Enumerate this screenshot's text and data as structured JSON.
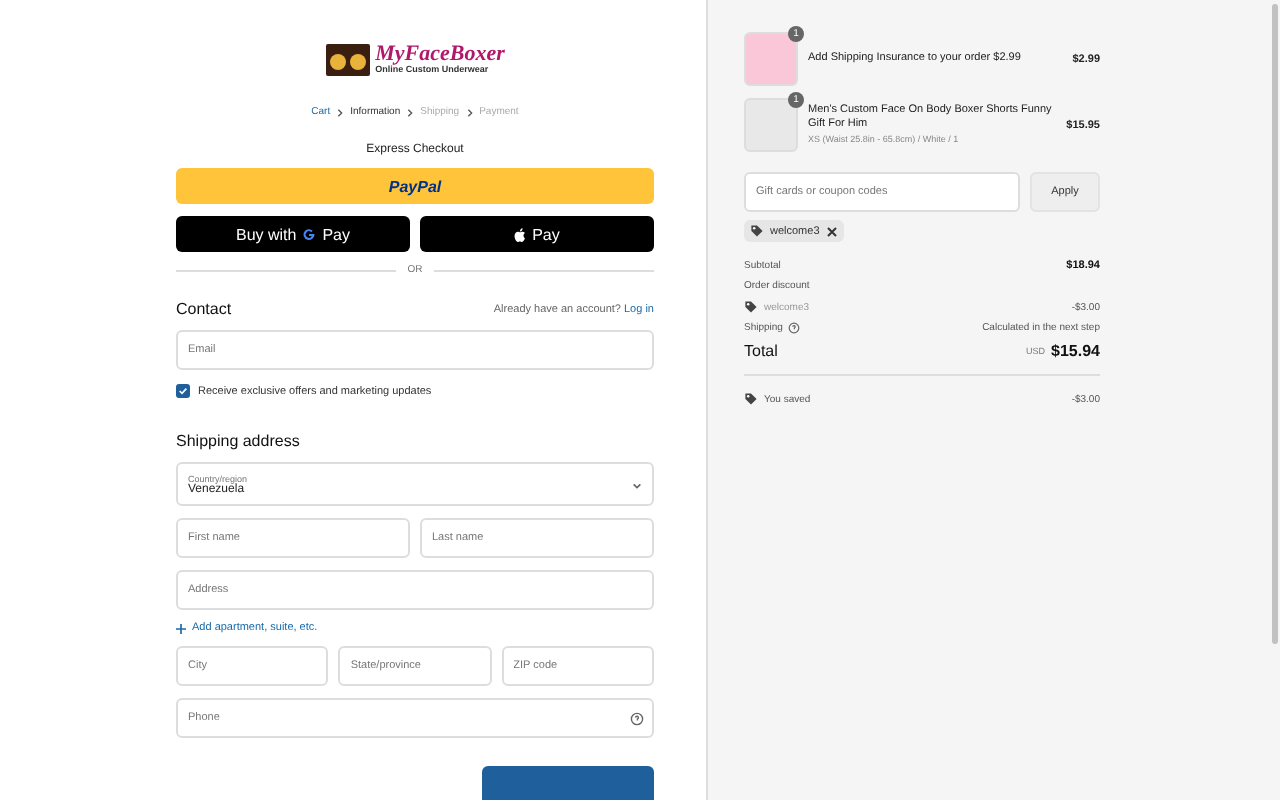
{
  "logo": {
    "name": "MyFaceBoxer",
    "tagline": "Online Custom Underwear"
  },
  "breadcrumbs": [
    {
      "label": "Cart",
      "kind": "link"
    },
    {
      "label": "Information",
      "kind": "current"
    },
    {
      "label": "Shipping",
      "kind": "pending"
    },
    {
      "label": "Payment",
      "kind": "pending"
    }
  ],
  "express": {
    "title": "Express Checkout",
    "paypal": "PayPal",
    "gpay_prefix": "Buy with",
    "gpay": "Pay",
    "applepay": "Pay",
    "divider": "OR"
  },
  "contact": {
    "title": "Contact",
    "account_prompt": "Already have an account?",
    "login": "Log in",
    "email": {
      "placeholder": "Email"
    },
    "marketing": {
      "label": "Receive exclusive offers and marketing updates",
      "checked": true
    }
  },
  "shipping": {
    "title": "Shipping address",
    "country": {
      "label": "Country/region",
      "value": "Venezuela"
    },
    "first_name": {
      "placeholder": "First name"
    },
    "last_name": {
      "placeholder": "Last name"
    },
    "address": {
      "placeholder": "Address"
    },
    "add_apartment": "Add apartment, suite, etc.",
    "city": {
      "placeholder": "City"
    },
    "state": {
      "placeholder": "State/province"
    },
    "zip": {
      "placeholder": "ZIP code"
    },
    "phone": {
      "placeholder": "Phone"
    }
  },
  "cart": {
    "items": [
      {
        "kind": "insurance",
        "quantity": "1",
        "title": "Add Shipping Insurance to your order $2.99",
        "price": "$2.99"
      },
      {
        "kind": "product",
        "quantity": "1",
        "title": "Men's Custom Face On Body Boxer Shorts Funny Gift For Him",
        "variant": "XS (Waist 25.8in - 65.8cm) / White / 1",
        "price": "$15.95"
      }
    ],
    "coupon": {
      "placeholder": "Gift cards or coupon codes",
      "button": "Apply"
    },
    "applied_code": "welcome3",
    "summary": {
      "subtotal_label": "Subtotal",
      "subtotal": "$18.94",
      "discount_label": "Order discount",
      "discount_code": "welcome3",
      "discount": "-$3.00",
      "shipping_label": "Shipping",
      "shipping": "Calculated in the next step",
      "total_label": "Total",
      "currency": "USD",
      "total": "$15.94",
      "saved_label": "You saved",
      "saved": "-$3.00"
    }
  }
}
